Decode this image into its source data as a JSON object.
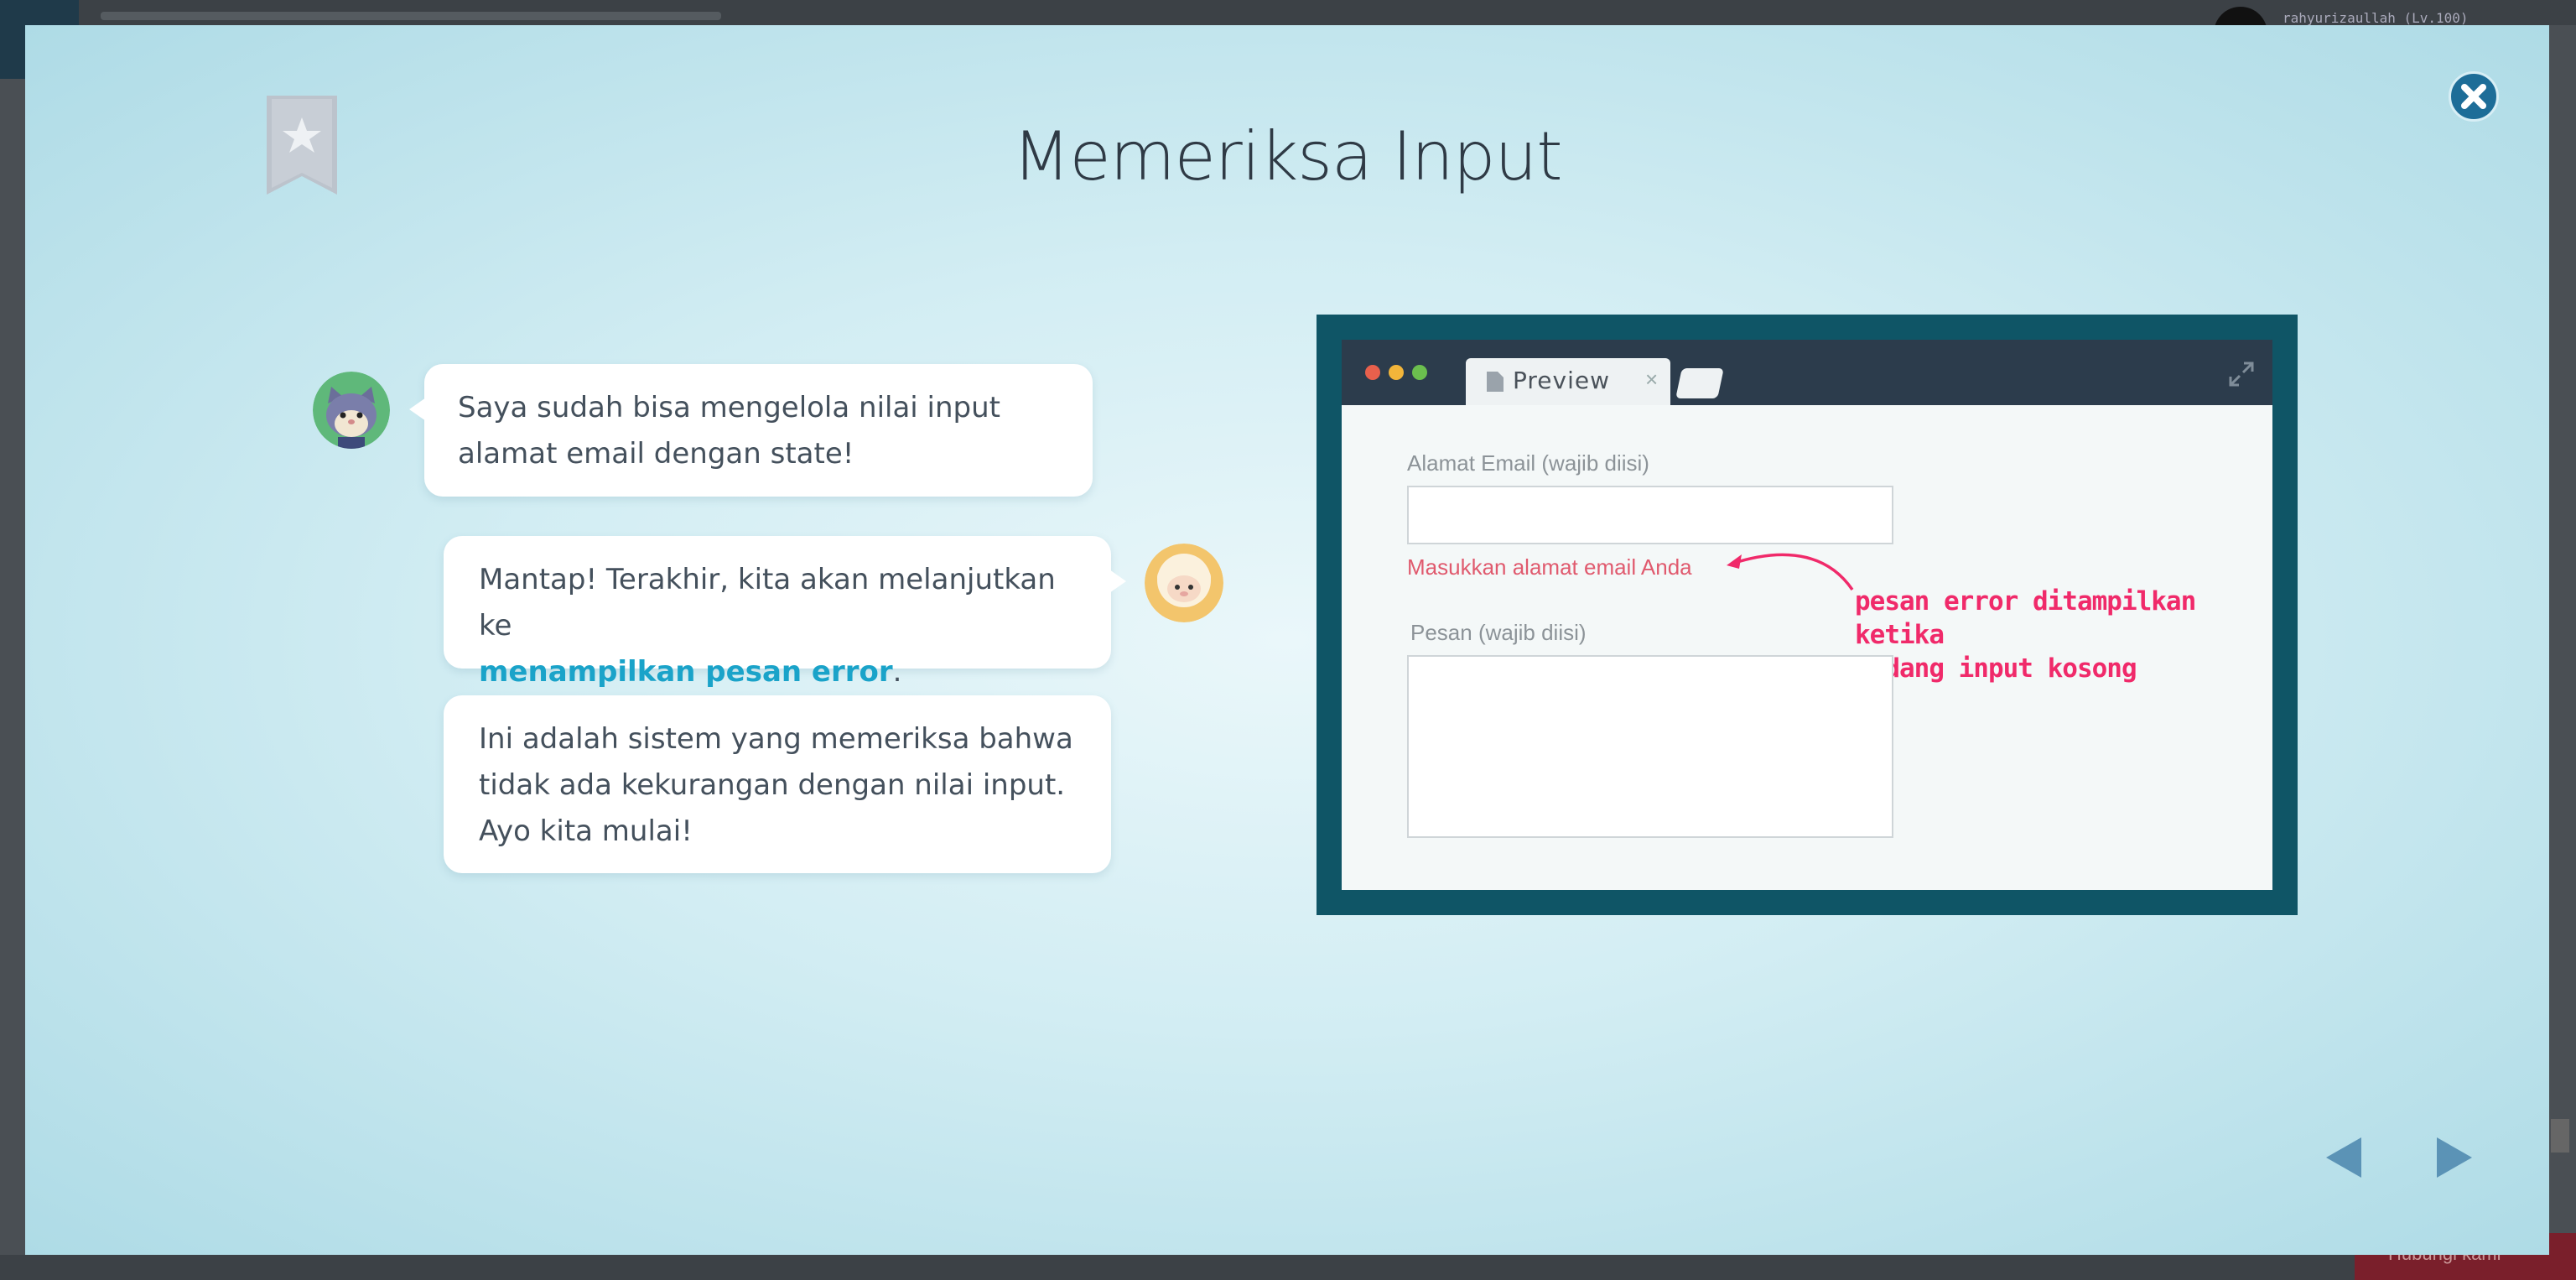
{
  "background": {
    "user_name": "rahyurizaullah (Lv.100)",
    "bottom_button": "Hubungi kami"
  },
  "modal": {
    "title": "Memeriksa Input",
    "chat": [
      {
        "speaker": "cat-avatar",
        "text": [
          "Saya sudah bisa mengelola nilai input",
          "alamat email dengan state!"
        ]
      },
      {
        "speaker": "sheep-avatar",
        "text_before": "Mantap! Terakhir, kita akan melanjutkan ke",
        "highlight": "menampilkan pesan error",
        "text_after": "."
      },
      {
        "speaker": "sheep-avatar",
        "text": [
          "Ini adalah sistem yang memeriksa bahwa",
          "tidak ada kekurangan dengan nilai input.",
          "Ayo kita mulai!"
        ]
      }
    ],
    "preview": {
      "tab_label": "Preview",
      "email_label": "Alamat Email (wajib diisi)",
      "email_error": "Masukkan alamat email Anda",
      "message_label": "Pesan (wajib diisi)",
      "annotation_line1": "pesan error ditampilkan ketika",
      "annotation_line2": "bidang input kosong"
    },
    "colors": {
      "accent": "#1aa3c9",
      "error": "#e05a6e",
      "annotation": "#f02a6a",
      "frame": "#0f5566"
    }
  }
}
